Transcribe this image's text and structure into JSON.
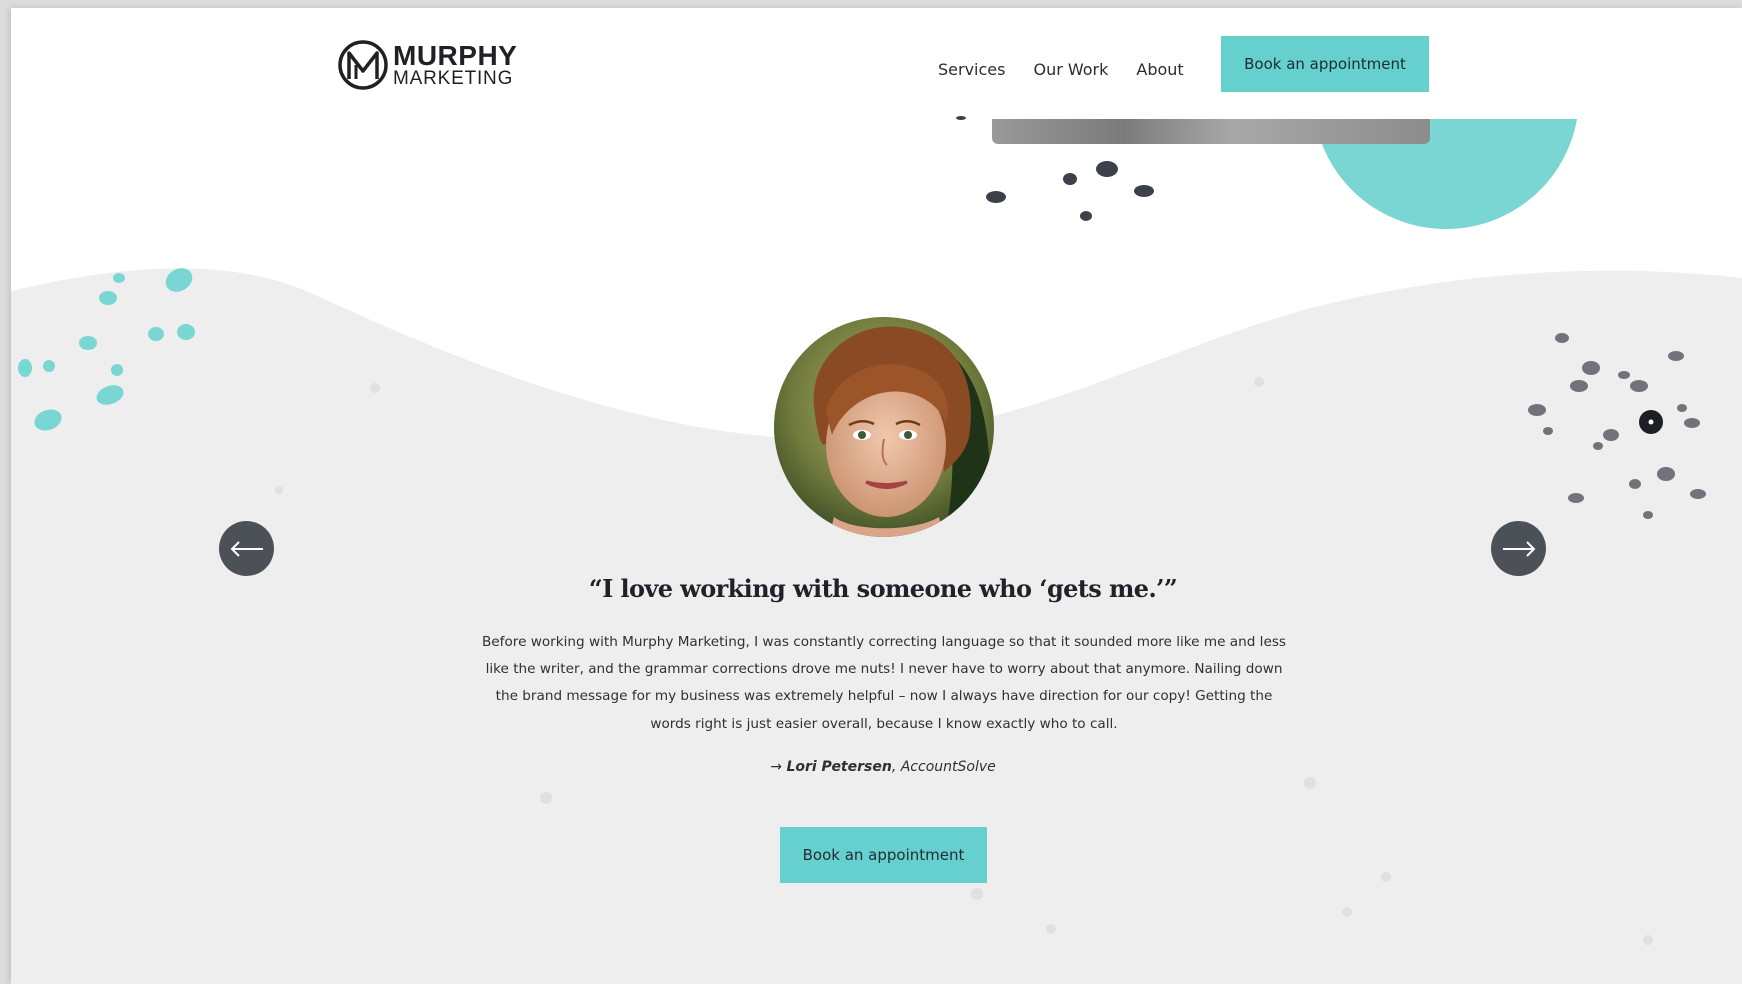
{
  "brand": {
    "name_line1": "MURPHY",
    "name_line2": "MARKETING",
    "accent": "#66d0cf",
    "dark": "#1f2125"
  },
  "nav": {
    "items": [
      {
        "label": "Services"
      },
      {
        "label": "Our Work"
      },
      {
        "label": "About"
      }
    ],
    "cta_label": "Book an appointment"
  },
  "testimonial": {
    "quote": "“I love working with someone who ‘gets me.’”",
    "body": "Before working with Murphy Marketing, I was constantly correcting language so that it sounded more like me and less like the writer, and the grammar corrections drove me nuts! I never have to worry about that anymore. Nailing down the brand message for my business was extremely helpful – now I always have direction for our copy! Getting the words right is just easier overall, because I know exactly who to call.",
    "arrow_prefix": "→",
    "author": "Lori Petersen",
    "company": "AccountSolve",
    "prev_icon": "arrow-left-icon",
    "next_icon": "arrow-right-icon"
  },
  "cta": {
    "label": "Book an appointment"
  }
}
